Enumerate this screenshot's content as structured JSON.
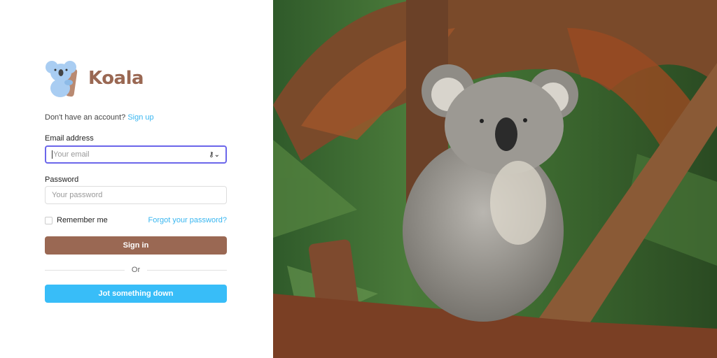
{
  "brand": {
    "name": "Koala"
  },
  "signup": {
    "prompt": "Don't have an account?",
    "link": "Sign up"
  },
  "email": {
    "label": "Email address",
    "placeholder": "Your email"
  },
  "password": {
    "label": "Password",
    "placeholder": "Your password"
  },
  "remember": {
    "label": "Remember me"
  },
  "forgot": {
    "label": "Forgot your password?"
  },
  "signin": {
    "label": "Sign in"
  },
  "divider": {
    "label": "Or"
  },
  "jot": {
    "label": "Jot something down"
  },
  "colors": {
    "brand": "#9a6853",
    "accent": "#38bdf8",
    "focus": "#6b66ea"
  }
}
